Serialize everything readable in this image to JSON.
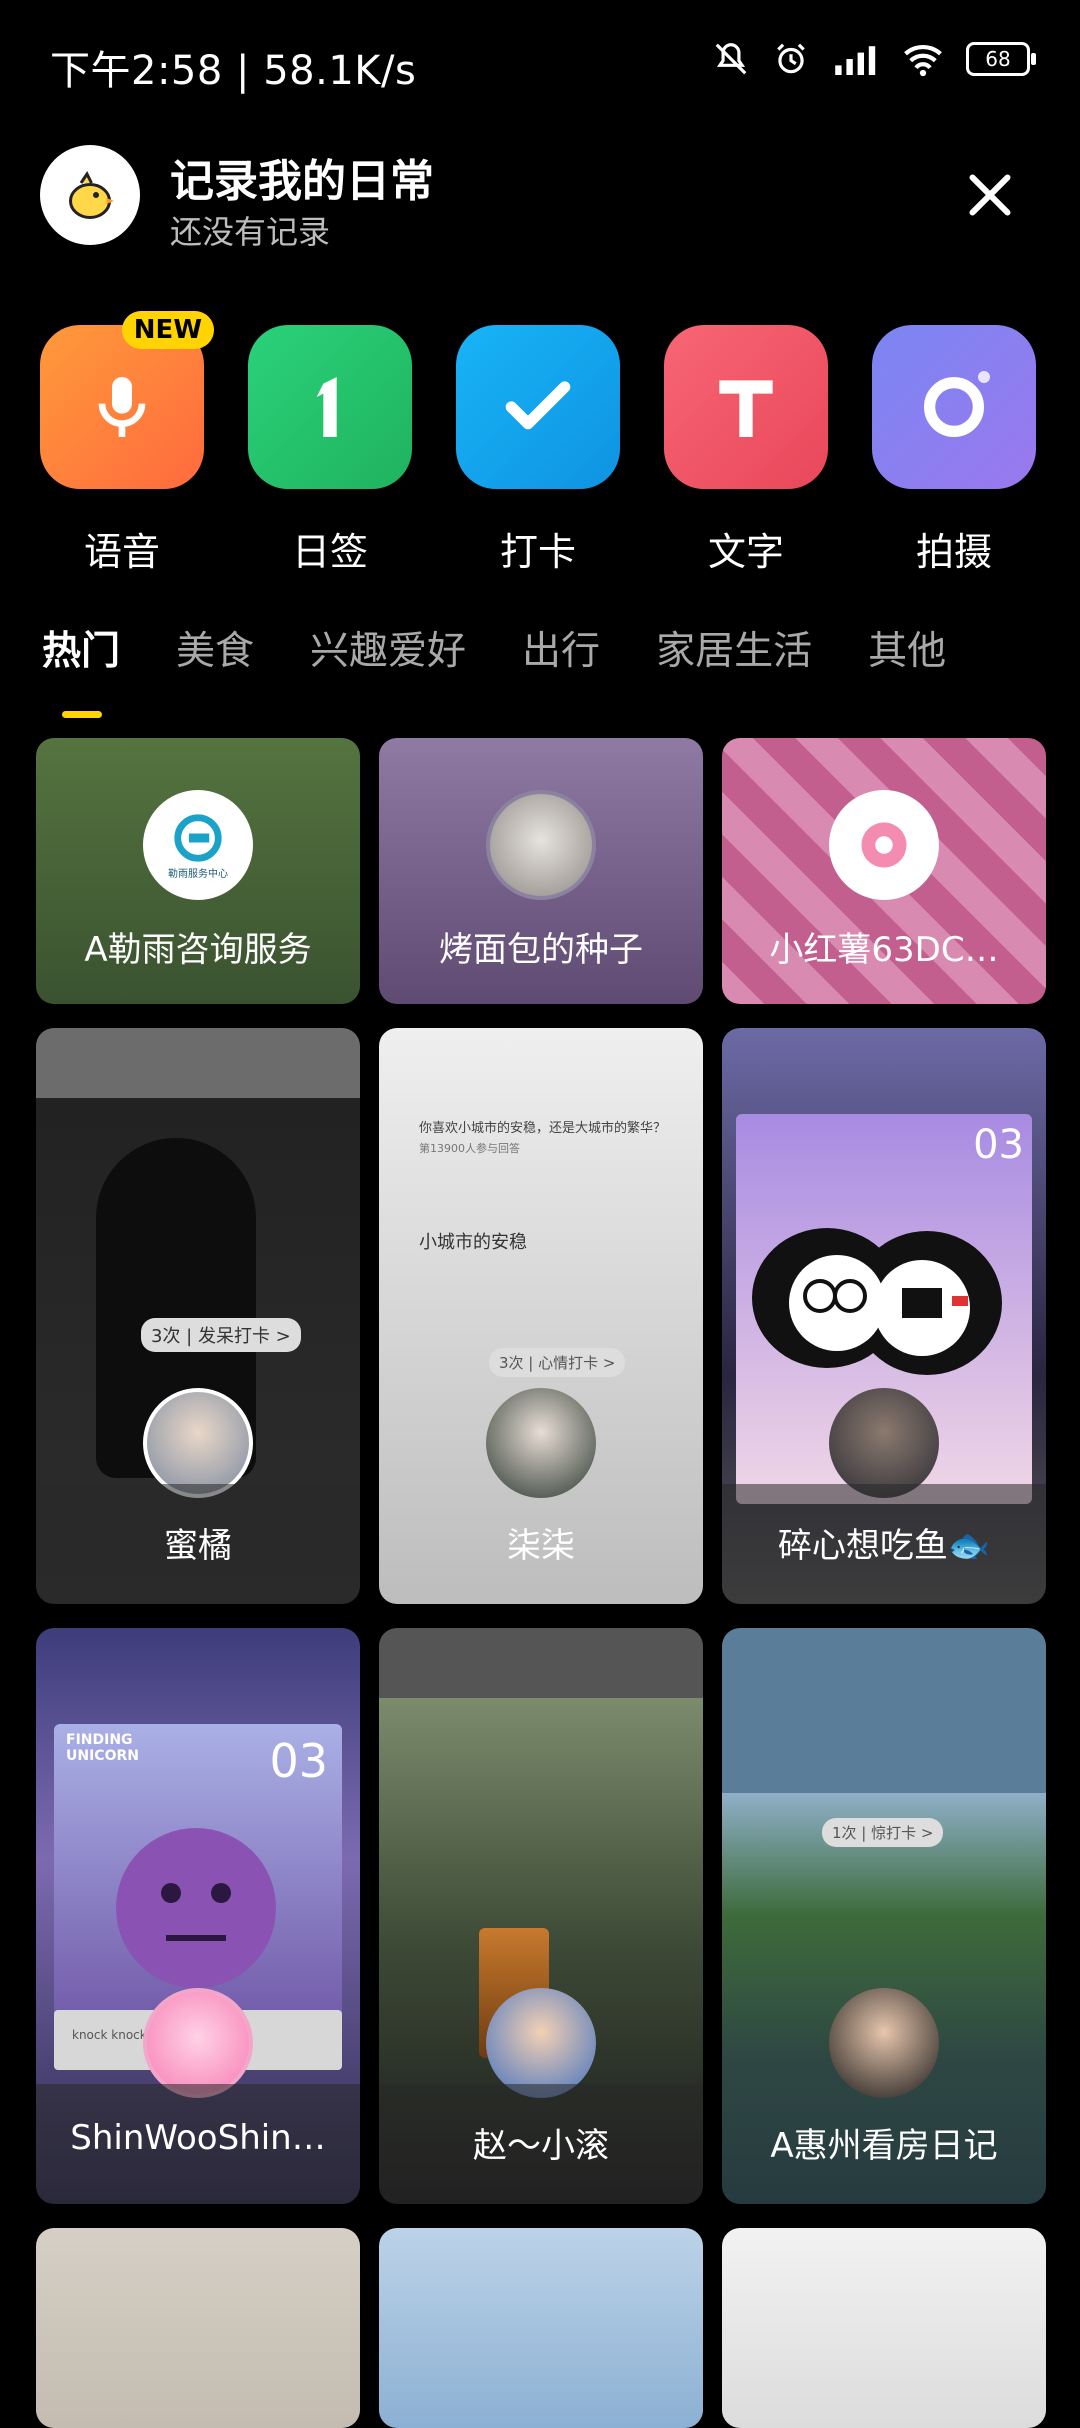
{
  "status": {
    "left_text": "下午2:58 | 58.1K/s",
    "battery": "68",
    "icons": [
      "mute-bell-icon",
      "alarm-icon",
      "signal-icon",
      "wifi-icon",
      "battery-icon"
    ]
  },
  "header": {
    "title": "记录我的日常",
    "subtitle": "还没有记录",
    "avatar_icon": "chick-icon",
    "close_icon": "close-icon"
  },
  "tools": [
    {
      "label": "语音",
      "icon": "mic-icon",
      "color": "#ff7a3d",
      "badge": "NEW"
    },
    {
      "label": "日签",
      "icon": "number-one-icon",
      "color": "#25c46a",
      "badge": ""
    },
    {
      "label": "打卡",
      "icon": "check-icon",
      "color": "#14a6ef",
      "badge": ""
    },
    {
      "label": "文字",
      "icon": "text-t-icon",
      "color": "#f15464",
      "badge": ""
    },
    {
      "label": "拍摄",
      "icon": "camera-circle-icon",
      "color": "#8a7df1",
      "badge": ""
    }
  ],
  "tabs": [
    {
      "label": "热门",
      "active": true
    },
    {
      "label": "美食",
      "active": false
    },
    {
      "label": "兴趣爱好",
      "active": false
    },
    {
      "label": "出行",
      "active": false
    },
    {
      "label": "家居生活",
      "active": false
    },
    {
      "label": "其他",
      "active": false
    }
  ],
  "cards": [
    {
      "name": "A勒雨咨询服务",
      "bg": "#3e5a32"
    },
    {
      "name": "烤面包的种子",
      "bg": "#6f567f"
    },
    {
      "name": "小红薯63DC…",
      "bg": "#c77ea0"
    },
    {
      "name": "蜜橘",
      "bg": "#3b3b3b"
    },
    {
      "name": "柒柒",
      "bg": "#cfcfcf"
    },
    {
      "name": "碎心想吃鱼🐟",
      "bg": "#4b3f73"
    },
    {
      "name": "ShinWooShin…",
      "bg": "#433b6f"
    },
    {
      "name": "赵～小滚",
      "bg": "#4a4a48"
    },
    {
      "name": "A惠州看房日记",
      "bg": "#314a53"
    },
    {
      "name": "",
      "bg": "#cfc8bd"
    },
    {
      "name": "",
      "bg": "#a8c4dc"
    },
    {
      "name": "",
      "bg": "#e8e8e8"
    }
  ],
  "card_text": {
    "card5_q": "你喜欢小城市的安稳，还是大城市的繁华？",
    "card5_count": "第13900人参与回答",
    "card5_answer": "小城市的安稳",
    "card5_pill": "3次 | 心情打卡 >",
    "card4_pill": "3次 | 发呆打卡 >",
    "card6_num": "03",
    "card7_num": "03",
    "card7_title": "FINDING UNICORN",
    "card7_note": "knock knock",
    "card9_pill": "1次 | 惊打卡 >",
    "card1_logo": "勒雨服务中心"
  }
}
